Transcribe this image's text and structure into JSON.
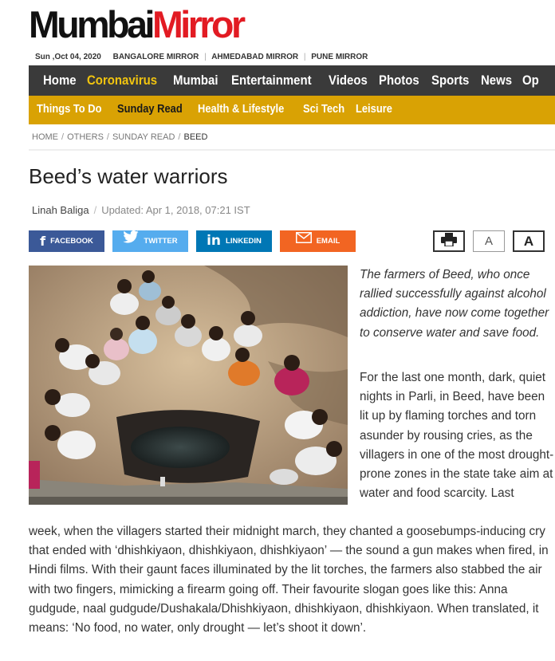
{
  "masthead": {
    "logo_part1": "Mumbai",
    "logo_part2": "Mirror",
    "date": "Sun ,Oct 04, 2020",
    "editions": [
      "BANGALORE MIRROR",
      "AHMEDABAD MIRROR",
      "PUNE MIRROR"
    ]
  },
  "nav_main": [
    {
      "label": "Home",
      "active": false
    },
    {
      "label": "Coronavirus",
      "active": true
    },
    {
      "label": "Mumbai",
      "active": false
    },
    {
      "label": "Entertainment",
      "active": false
    },
    {
      "label": "Videos",
      "active": false
    },
    {
      "label": "Photos",
      "active": false
    },
    {
      "label": "Sports",
      "active": false
    },
    {
      "label": "News",
      "active": false
    },
    {
      "label": "Op",
      "active": false
    }
  ],
  "nav_sub": [
    {
      "label": "Things To Do",
      "active": false
    },
    {
      "label": "Sunday Read",
      "active": true
    },
    {
      "label": "Health & Lifestyle",
      "active": false
    },
    {
      "label": "Sci Tech",
      "active": false
    },
    {
      "label": "Leisure",
      "active": false
    }
  ],
  "breadcrumb": [
    "HOME",
    "OTHERS",
    "SUNDAY READ",
    "BEED"
  ],
  "article": {
    "title": "Beed’s water warriors",
    "author": "Linah Baliga",
    "updated": "Updated: Apr 1, 2018, 07:21 IST",
    "lede": "The farmers of Beed, who once rallied successfully against alcohol addiction, have now come together to conserve water and save food.",
    "para_right": "For the last one month, dark, quiet nights in Parli, in Beed, have been lit up by flaming torches and torn asunder by rousing cries, as the villagers in one of the most drought-prone zones in the state take aim at water and food scarcity. Last",
    "para_full": "week, when the villagers started their midnight march, they chanted a goosebumps-inducing cry that ended with ‘dhishkiyaon, dhishkiyaon, dhishkiyaon’ — the sound a gun makes when fired, in Hindi films. With their gaunt faces illuminated by the lit torches, the farmers also stabbed the air with two fingers, mimicking a firearm going off. Their favourite slogan goes like this: Anna gudgude, naal gudgude/Dushakala/Dhishkiyaon, dhishkiyaon, dhishkiyaon. When translated, it means: ‘No food, no water, only drought — let’s shoot it down’."
  },
  "share": {
    "facebook": "FACEBOOK",
    "twitter": "TWITTER",
    "linkedin": "LINKEDIN",
    "email": "EMAIL"
  },
  "tools": {
    "font_small": "A",
    "font_large": "A",
    "print_icon": "printer-icon"
  },
  "colors": {
    "brand_red": "#e21b23",
    "nav_dark": "#3a3a3a",
    "nav_gold": "#d9a204",
    "active_yellow": "#f1c40f"
  }
}
